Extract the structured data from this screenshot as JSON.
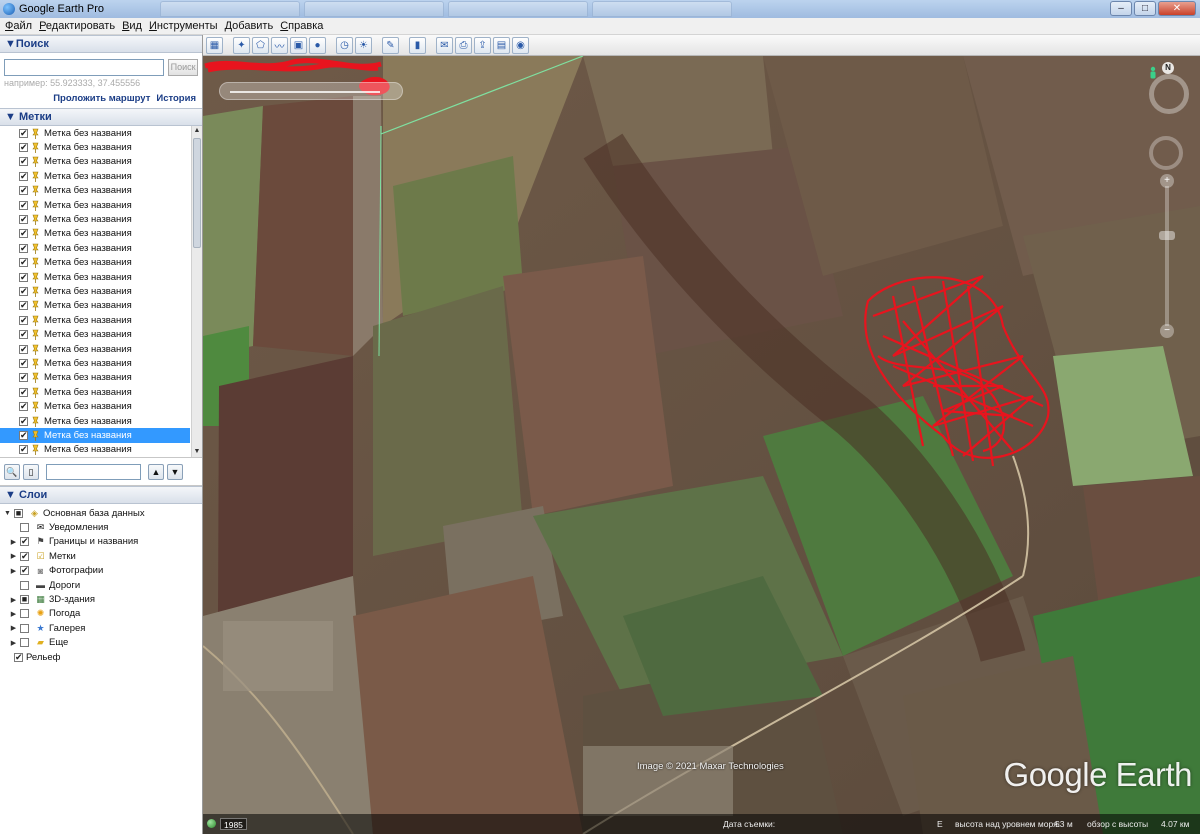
{
  "window": {
    "title": "Google Earth Pro",
    "controls": [
      "–",
      "□",
      "✕"
    ]
  },
  "menu": [
    {
      "label": "Файл",
      "underline": "Ф"
    },
    {
      "label": "Редактировать",
      "underline": "Р"
    },
    {
      "label": "Вид",
      "underline": "В"
    },
    {
      "label": "Инструменты",
      "underline": "И"
    },
    {
      "label": "Добавить",
      "underline": "Д"
    },
    {
      "label": "Справка",
      "underline": "С"
    }
  ],
  "search": {
    "header": "▼Поиск",
    "input_value": "",
    "button_label": "Поиск",
    "hint": "например: 55.923333, 37.455556",
    "route_link": "Проложить маршрут",
    "history_link": "История"
  },
  "places": {
    "header": "▼ Метки",
    "items": [
      "Метка без названия",
      "Метка без названия",
      "Метка без названия",
      "Метка без названия",
      "Метка без названия",
      "Метка без названия",
      "Метка без названия",
      "Метка без названия",
      "Метка без названия",
      "Метка без названия",
      "Метка без названия",
      "Метка без названия",
      "Метка без названия",
      "Метка без названия",
      "Метка без названия",
      "Метка без названия",
      "Метка без названия",
      "Метка без названия",
      "Метка без названия",
      "Метка без названия",
      "Метка без названия",
      "Метка без названия",
      "Метка без названия"
    ],
    "selected_index": 21
  },
  "layers": {
    "header": "▼ Слои",
    "items": [
      {
        "label": "Основная база данных",
        "indent": 0,
        "expander": "▼",
        "check": "■",
        "icon": "database-icon"
      },
      {
        "label": "Уведомления",
        "indent": 1,
        "expander": "",
        "check": "",
        "icon": "mail-icon"
      },
      {
        "label": "Границы и названия",
        "indent": 1,
        "expander": "▶",
        "check": "✔",
        "icon": "flag-icon"
      },
      {
        "label": "Метки",
        "indent": 1,
        "expander": "▶",
        "check": "✔",
        "icon": "checkbox-icon"
      },
      {
        "label": "Фотографии",
        "indent": 1,
        "expander": "▶",
        "check": "✔",
        "icon": "camera-icon"
      },
      {
        "label": "Дороги",
        "indent": 1,
        "expander": "",
        "check": "",
        "icon": "road-icon"
      },
      {
        "label": "3D-здания",
        "indent": 1,
        "expander": "▶",
        "check": "■",
        "icon": "building-icon"
      },
      {
        "label": "Погода",
        "indent": 1,
        "expander": "▶",
        "check": "",
        "icon": "sun-icon"
      },
      {
        "label": "Галерея",
        "indent": 1,
        "expander": "▶",
        "check": "",
        "icon": "star-icon"
      },
      {
        "label": "Еще",
        "indent": 1,
        "expander": "▶",
        "check": "",
        "icon": "folder-icon"
      },
      {
        "label": "Рельеф",
        "indent": 0,
        "expander": "",
        "check": "✔",
        "icon": ""
      }
    ]
  },
  "map": {
    "imagery_credit": "Image © 2021 Maxar Technologies",
    "logo": "Google Earth",
    "compass_label": "N",
    "status": {
      "year": "1985",
      "date_label": "Дата съемки:",
      "coords_fragment": "Е",
      "elevation": "высота над уровнем моря:",
      "elevation_value": "53 м",
      "eye_alt_label": "обзор с высоты",
      "eye_alt_value": "4.07 км"
    }
  }
}
